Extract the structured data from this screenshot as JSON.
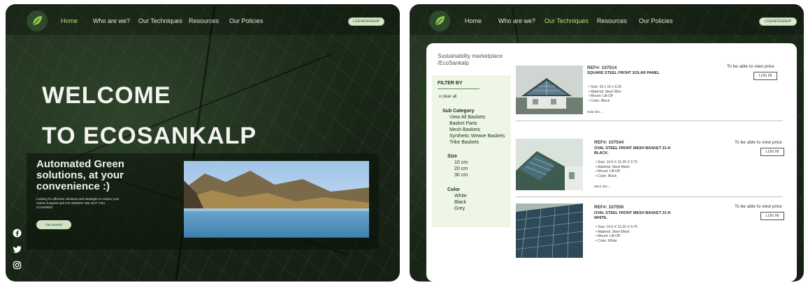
{
  "left": {
    "nav": {
      "items": [
        "Home",
        "Who are we?",
        "Our Techniques",
        "Resources",
        "Our Policies"
      ],
      "login": "LOGIN/SIGNUP"
    },
    "welcome_line1": "WELCOME",
    "welcome_line2": "TO ECOSANKALP",
    "hero_title": "Automated Green solutions, at your convenience :)",
    "hero_text": "Looking for effective solutions and strategies to reduce your carbon footprint and GO GREEN? WE GOT YOU COVERED!",
    "cta": "Get started!",
    "social": [
      "facebook-icon",
      "twitter-icon",
      "instagram-icon"
    ]
  },
  "right": {
    "nav": {
      "items": [
        "Home",
        "Who are we?",
        "Our Techniques",
        "Resources",
        "Our Policies"
      ],
      "login": "LOGIN/SIGNUP"
    },
    "breadcrumb": [
      "Sustainability marketplace",
      "/EcoSankalp"
    ],
    "filter": {
      "title": "FILTER BY",
      "clear": "x  clear all",
      "subcategory": {
        "title": "Sub Category",
        "items": [
          "View All Baskets",
          "Basket Parts",
          "Mesh Baskets",
          "Synthetic Weave Baskets",
          "Trike Baskets"
        ]
      },
      "size": {
        "title": "Size",
        "items": [
          "10 cm",
          "20 cm",
          "30 cm"
        ]
      },
      "color": {
        "title": "Color",
        "items": [
          "White",
          "Black",
          "Grey"
        ]
      }
    },
    "products": [
      {
        "ref": "REF#: 107514",
        "name": "SQUARE STEEL FRONT SOLAR PANEL",
        "specs": [
          "Size: 15 x 10 x 9.25",
          "Material: Steel Wire",
          "Mount: Lift-Off",
          "Color: Black"
        ],
        "more": "Hide Info  ⌄",
        "price": "To be able to view price",
        "button": "LOG IN"
      },
      {
        "ref": "REF#: 107544",
        "name": "OVAL STEEL FRONT MESH BASKET 21-H BLACK.",
        "specs": [
          "Size: 14.5 X 10.25 X 9.75",
          "Material: Steel Mesh",
          "Mount: Lift-Off",
          "Color: Black"
        ],
        "more": "More Info  ⌄",
        "price": "To be able to view price",
        "button": "LOG IN"
      },
      {
        "ref": "REF#: 107550",
        "name": "OVAL STEEL FRONT MESH BASKET 21-H WHITE.",
        "specs": [
          "Size: 14.5 X 10.25 X 9.75",
          "Material: Steel Mesh",
          "Mount: Lift-Off",
          "Color: White"
        ],
        "more": "",
        "price": "To be able to view price",
        "button": "LOG IN"
      }
    ]
  },
  "colors": {
    "accent": "#b8e07a",
    "leaf_dark": "#1a2818",
    "filter_bg": "#eef7e6"
  }
}
